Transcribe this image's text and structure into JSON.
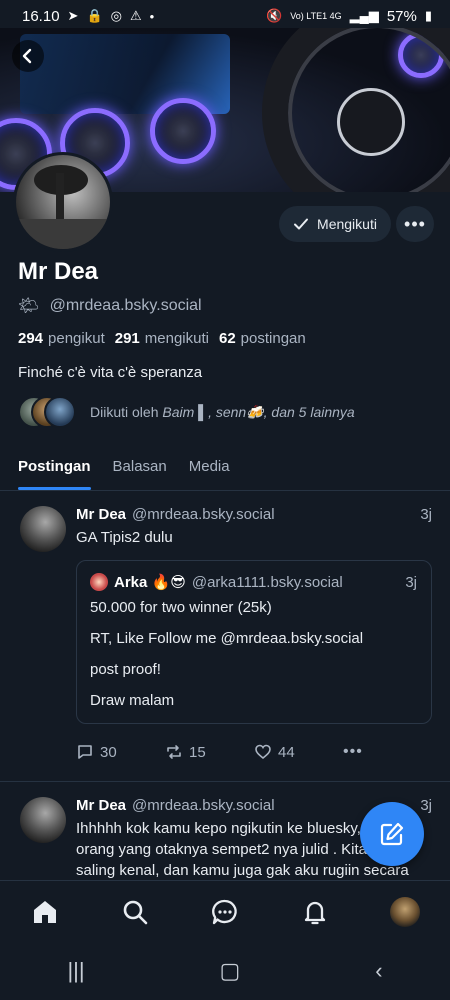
{
  "status_bar": {
    "time": "16.10",
    "network": "Vo) LTE1 4G",
    "battery": "57%"
  },
  "profile": {
    "name": "Mr Dea",
    "handle": "@mrdeaa.bsky.social",
    "follow_button_label": "Mengikuti",
    "stats": {
      "followers_count": "294",
      "followers_label": "pengikut",
      "following_count": "291",
      "following_label": "mengikuti",
      "posts_count": "62",
      "posts_label": "postingan"
    },
    "bio": "Finché c'è vita c'è speranza",
    "followed_by": {
      "prefix": "Diikuti oleh",
      "names": "Baim ▌, senn🍻, dan 5 lainnya"
    }
  },
  "tabs": [
    {
      "label": "Postingan",
      "active": true
    },
    {
      "label": "Balasan",
      "active": false
    },
    {
      "label": "Media",
      "active": false
    }
  ],
  "posts": [
    {
      "author_name": "Mr Dea",
      "author_handle": "@mrdeaa.bsky.social",
      "time": "3j",
      "text": "GA Tipis2 dulu",
      "quote": {
        "author_name": "Arka 🔥😎",
        "author_handle": "@arka1111.bsky.social",
        "time": "3j",
        "lines": [
          "50.000 for two winner (25k)",
          "RT, Like Follow me @mrdeaa.bsky.social",
          "post proof!",
          "Draw malam"
        ]
      },
      "replies": "30",
      "reposts": "15",
      "likes": "44"
    },
    {
      "author_name": "Mr Dea",
      "author_handle": "@mrdeaa.bsky.social",
      "time": "3j",
      "text": "Ihhhhh kok kamu kepo ngikutin ke bluesky, kaya orang yang otaknya sempet2 nya julid . Kita gak saling kenal, dan kamu juga gak aku rugiin secara Materil /"
    }
  ],
  "colors": {
    "background": "#131a24",
    "accent": "#2f86f6",
    "muted_text": "#aab4c2"
  },
  "icons": {
    "back": "chevron-left-icon",
    "follow_check": "check-icon",
    "more": "ellipsis-icon",
    "reply": "speech-bubble-icon",
    "repost": "repost-icon",
    "like": "heart-icon",
    "compose": "pencil-square-icon",
    "nav_home": "home-icon",
    "nav_search": "search-icon",
    "nav_chat": "chat-icon",
    "nav_notifications": "bell-icon"
  }
}
